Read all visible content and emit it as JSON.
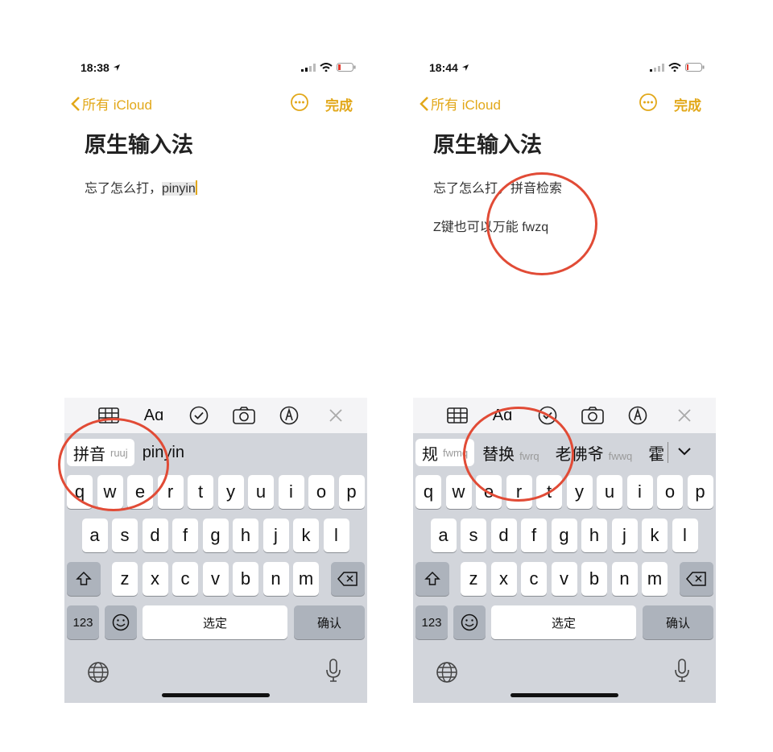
{
  "colors": {
    "accent": "#e2a81a",
    "annotation": "#e14b36",
    "keyboard_bg": "#d2d5db"
  },
  "left": {
    "status": {
      "time": "18:38"
    },
    "nav": {
      "back": "所有 iCloud",
      "done": "完成"
    },
    "note": {
      "title": "原生输入法",
      "line1_prefix": "忘了怎么打，",
      "line1_marked": "pinyin"
    },
    "candidates": [
      {
        "text": "拼音",
        "hint": "ruuj"
      },
      {
        "text": "pinyin",
        "hint": ""
      }
    ],
    "keys": {
      "space": "选定",
      "confirm": "确认",
      "numbers": "123"
    }
  },
  "right": {
    "status": {
      "time": "18:44"
    },
    "nav": {
      "back": "所有 iCloud",
      "done": "完成"
    },
    "note": {
      "title": "原生输入法",
      "line1": "忘了怎么打，拼音检索",
      "line2": "Z键也可以万能 fwzq"
    },
    "candidates": [
      {
        "text": "规",
        "hint": "fwmq"
      },
      {
        "text": "替换",
        "hint": "fwrq"
      },
      {
        "text": "老佛爷",
        "hint": "fwwq"
      },
      {
        "text": "霍",
        "hint": ""
      }
    ],
    "keys": {
      "space": "选定",
      "confirm": "确认",
      "numbers": "123"
    }
  },
  "keyboard_rows": {
    "row1": [
      "q",
      "w",
      "e",
      "r",
      "t",
      "y",
      "u",
      "i",
      "o",
      "p"
    ],
    "row2": [
      "a",
      "s",
      "d",
      "f",
      "g",
      "h",
      "j",
      "k",
      "l"
    ],
    "row3": [
      "z",
      "x",
      "c",
      "v",
      "b",
      "n",
      "m"
    ]
  },
  "icons": [
    "location-arrow-icon",
    "signal-icon",
    "wifi-icon",
    "battery-icon",
    "chevron-left-icon",
    "more-icon",
    "table-icon",
    "text-format-icon",
    "checklist-icon",
    "camera-icon",
    "markup-icon",
    "close-icon",
    "shift-icon",
    "delete-icon",
    "emoji-icon",
    "globe-icon",
    "mic-icon",
    "chevron-down-icon"
  ]
}
